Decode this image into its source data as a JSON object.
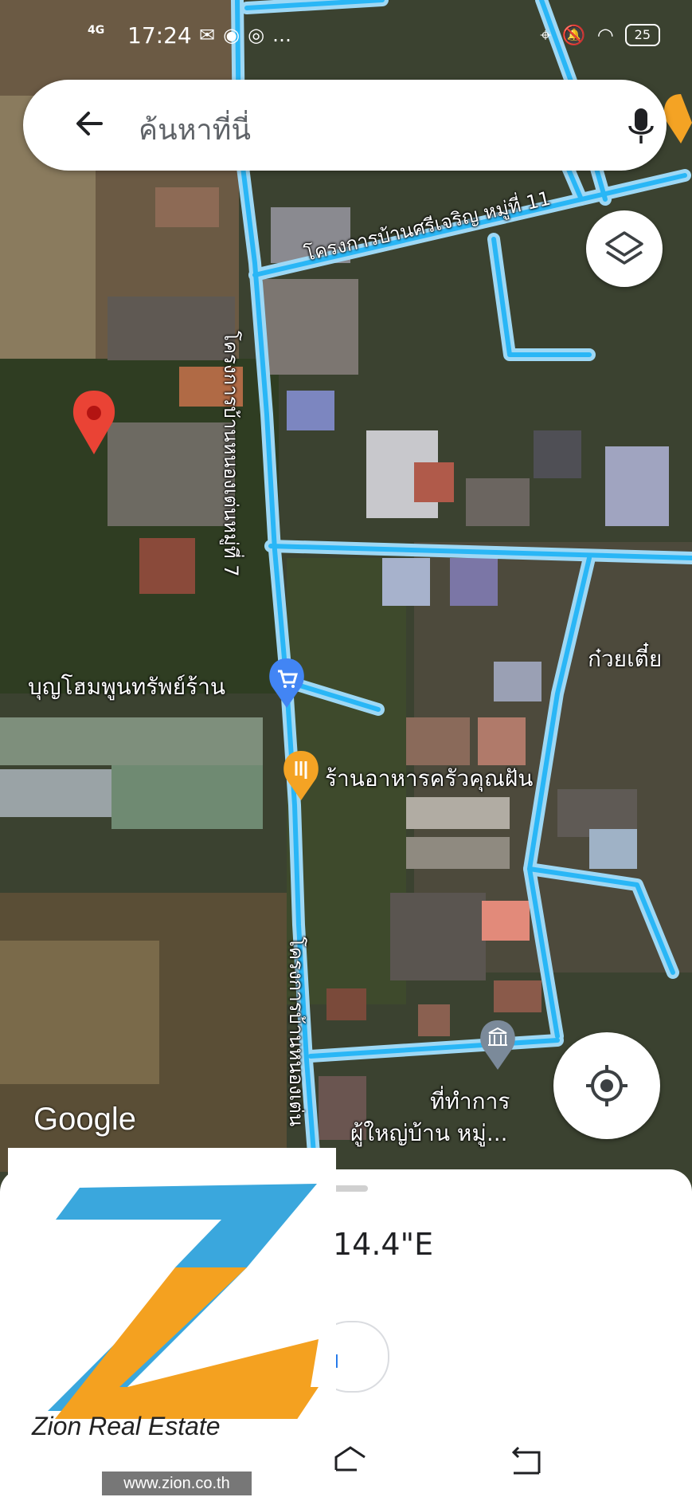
{
  "status_bar": {
    "network": "4G",
    "time": "17:24",
    "battery": "25",
    "left_icons": [
      "mail-icon",
      "chat-icon",
      "chrome-icon",
      "more-icon"
    ],
    "right_icons": [
      "location-icon",
      "mute-icon",
      "wifi-icon",
      "battery-icon"
    ]
  },
  "search": {
    "placeholder": "ค้นหาที่นี่"
  },
  "map": {
    "labels": {
      "road_top": "โครงการบ้านศรีเจริญ หมู่ที่ 11",
      "road_left_vertical": "โครงการบ้านหนองเต่นหมู่ที่ 7",
      "road_bottom_vertical": "โครงการบ้านหนองเต่น",
      "shop": "บุญโฮมพูนทรัพย์ร้าน",
      "restaurant": "ร้านอาหารครัวคุณฝัน",
      "noodle": "ก๋วยเตี๋ย",
      "office_line1": "ที่ทำการ",
      "office_line2": "ผู้ใหญ่บ้าน หมู่..."
    },
    "google_logo": "Google"
  },
  "sheet": {
    "coords": "14.4\"E",
    "chip_label": "ม"
  },
  "overlay": {
    "brand": "Zion Real Estate",
    "website": "www.zion.co.th"
  },
  "colors": {
    "road": "#4fc3f7",
    "pin": "#ea4335",
    "poi_food": "#f4a324",
    "poi_shop": "#4285f4",
    "zion_blue": "#3aa7dd",
    "zion_orange": "#f4a120"
  }
}
